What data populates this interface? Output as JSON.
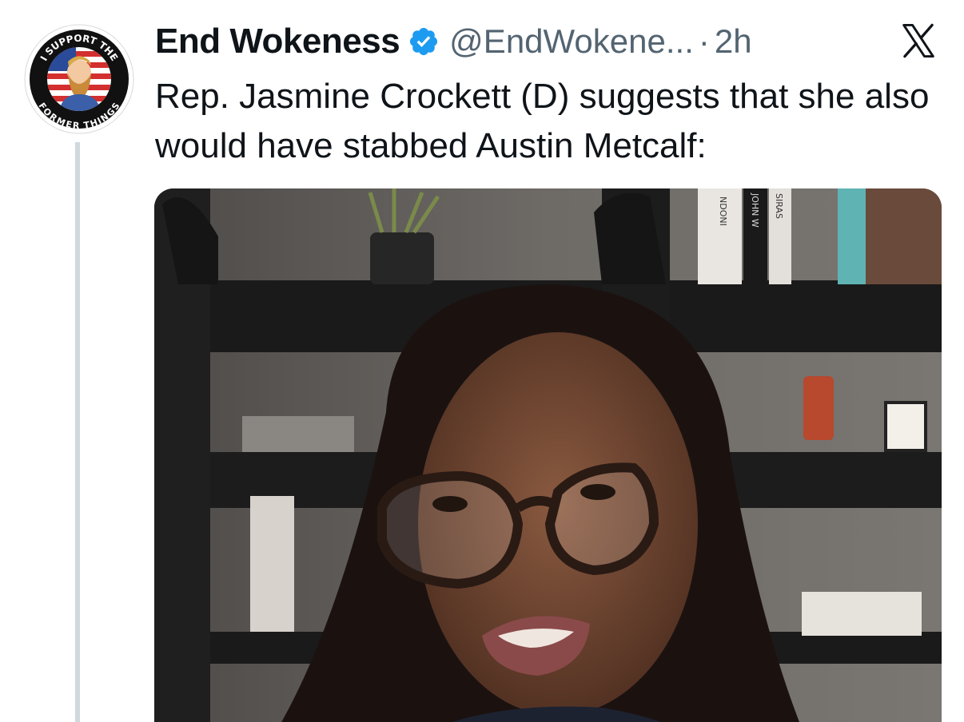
{
  "tweet": {
    "author_name": "End Wokeness",
    "handle": "@EndWokene...",
    "separator": "·",
    "time": "2h",
    "text": "Rep. Jasmine Crockett (D) suggests that she also would have stabbed Austin Metcalf:"
  },
  "avatar": {
    "badge_text_top": "I SUPPORT THE",
    "badge_text_bottom": "FORMER THINGS"
  },
  "icons": {
    "verified": "verified-badge-icon",
    "x_logo": "x-logo-icon"
  },
  "media": {
    "book_spines": [
      "NDONI",
      "JOHN W",
      "SIRAS"
    ]
  },
  "colors": {
    "verified_blue": "#1d9bf0",
    "text_primary": "#0f1419",
    "text_secondary": "#536471",
    "thread_line": "#cfd9de"
  }
}
